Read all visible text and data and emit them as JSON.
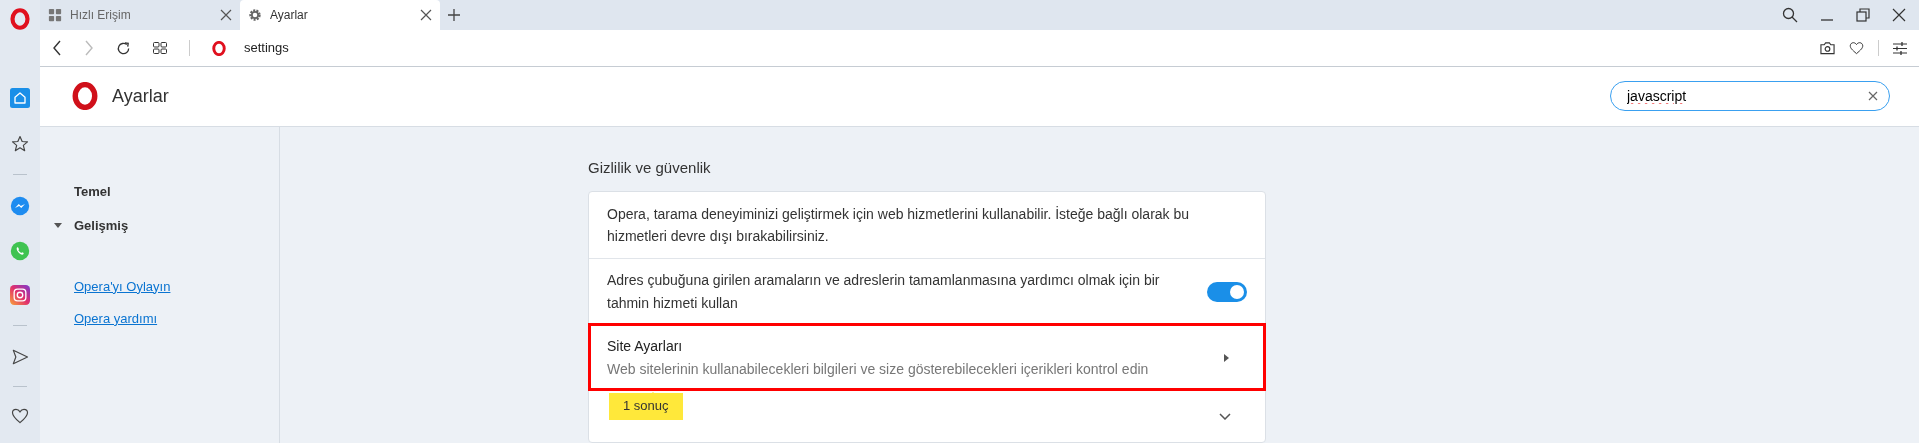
{
  "tabs": [
    {
      "label": "Hızlı Erişim",
      "kind": "speed-dial",
      "selected": false
    },
    {
      "label": "Ayarlar",
      "kind": "settings",
      "selected": true
    }
  ],
  "address_bar": {
    "url": "settings"
  },
  "settings_header": {
    "title": "Ayarlar",
    "search": {
      "value": "javascript"
    }
  },
  "nav": {
    "items": [
      {
        "label": "Temel",
        "kind": "plain"
      },
      {
        "label": "Gelişmiş",
        "kind": "group",
        "expanded": true
      }
    ],
    "links": [
      "Opera'yı Oylayın",
      "Opera yardımı"
    ]
  },
  "section": {
    "title": "Gizlilik ve güvenlik",
    "rows": [
      {
        "kind": "text",
        "text": "Opera, tarama deneyiminizi geliştirmek için web hizmetlerini kullanabilir. İsteğe bağlı olarak bu hizmetleri devre dışı bırakabilirsiniz."
      },
      {
        "kind": "toggle",
        "text": "Adres çubuğuna girilen aramaların ve adreslerin tamamlanmasına yardımcı olmak için bir tahmin hizmeti kullan",
        "on": true
      },
      {
        "kind": "link",
        "title": "Site Ayarları",
        "subtitle": "Web sitelerinin kullanabilecekleri bilgileri ve size gösterebilecekleri içerikleri kontrol edin",
        "highlighted": true
      },
      {
        "kind": "expand"
      }
    ],
    "tooltip": "1 sonuç"
  }
}
